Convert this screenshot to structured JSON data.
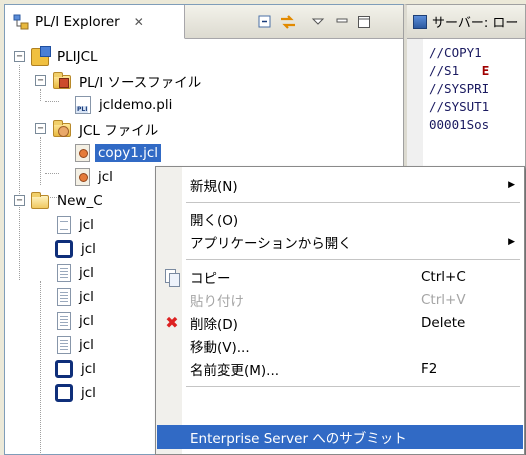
{
  "explorer": {
    "tab_title": "PL/I Explorer",
    "tab_close": "✕",
    "tools": [
      "collapse-all-icon",
      "link-with-editor-icon",
      "view-menu-icon",
      "minimize-icon",
      "maximize-icon"
    ]
  },
  "tree": {
    "project": "PLIJCL",
    "pli_folder": "PL/I ソースファイル",
    "pli_file": "jcldemo.pli",
    "jcl_folder": "JCL ファイル",
    "jcl_files": [
      "copy1.jcl",
      "jcl"
    ],
    "new_folder": "New_C",
    "new_items": [
      "jcl",
      "jcl",
      "jcl",
      "jcl",
      "jcl",
      "jcl",
      "jcl",
      "jcl"
    ]
  },
  "editor": {
    "tab_title": "サーバー: ロー",
    "lines": [
      {
        "text": "//COPY1",
        "red": ""
      },
      {
        "text": "//S1   ",
        "red": "E"
      },
      {
        "text": "//SYSPRI",
        "red": ""
      },
      {
        "text": "//SYSUT1",
        "red": ""
      },
      {
        "text": "00001Sos",
        "red": ""
      }
    ]
  },
  "context_menu": {
    "new": {
      "label": "新規(N)"
    },
    "open": {
      "label": "開く(O)"
    },
    "open_with": {
      "label": "アプリケーションから開く"
    },
    "copy": {
      "label": "コピー",
      "accel": "Ctrl+C"
    },
    "paste": {
      "label": "貼り付け",
      "accel": "Ctrl+V"
    },
    "delete": {
      "label": "削除(D)",
      "accel": "Delete"
    },
    "move": {
      "label": "移動(V)..."
    },
    "rename": {
      "label": "名前変更(M)...",
      "accel": "F2"
    },
    "submit": {
      "label": "Enterprise Server へのサブミット"
    }
  }
}
